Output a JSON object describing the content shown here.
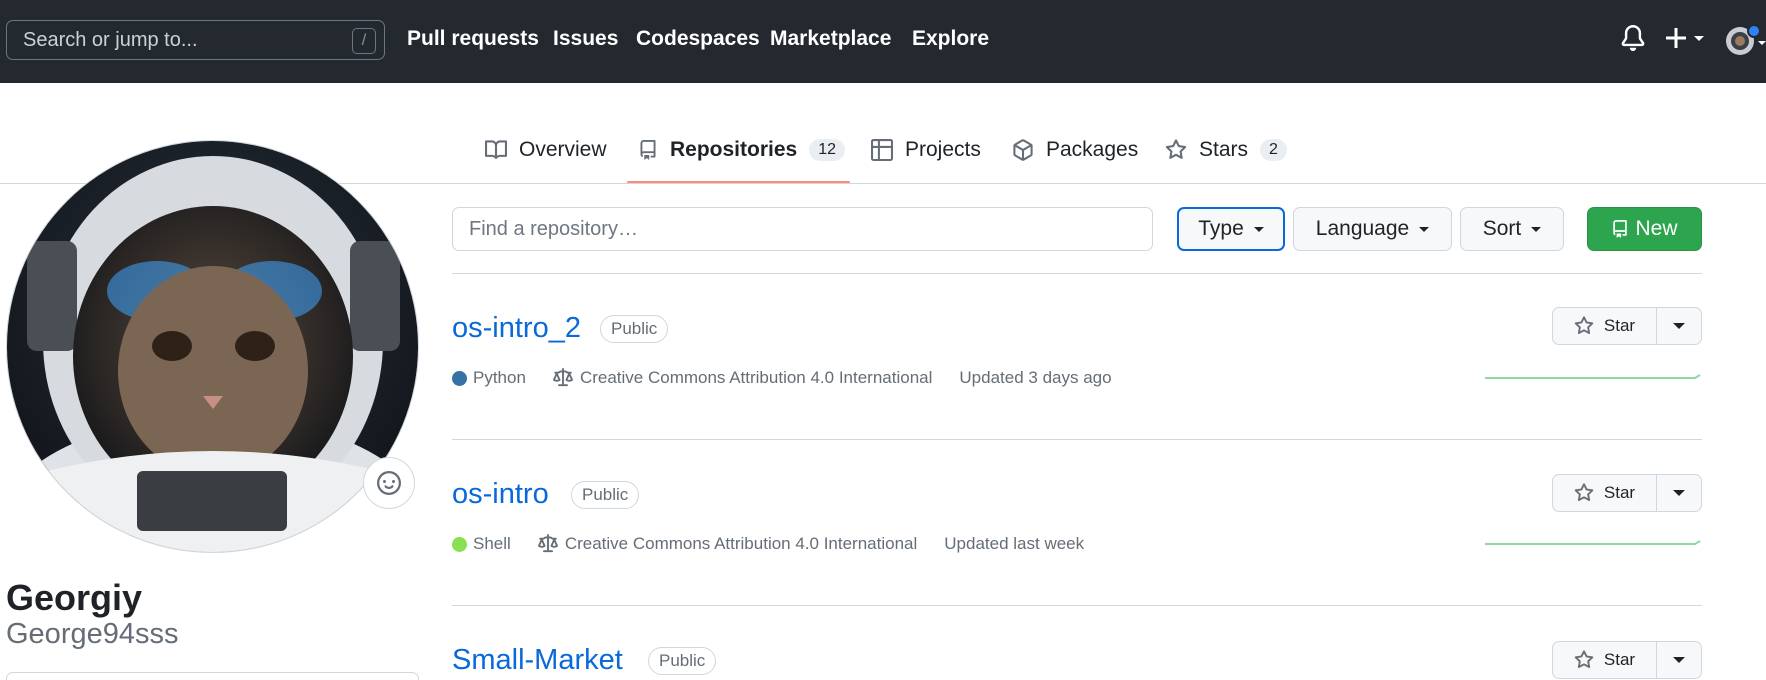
{
  "header": {
    "search_placeholder": "Search or jump to...",
    "search_shortcut": "/",
    "nav": [
      "Pull requests",
      "Issues",
      "Codespaces",
      "Marketplace",
      "Explore"
    ]
  },
  "tabs": [
    {
      "label": "Overview",
      "icon": "book-icon"
    },
    {
      "label": "Repositories",
      "icon": "repo-icon",
      "count": "12",
      "active": true
    },
    {
      "label": "Projects",
      "icon": "table-icon"
    },
    {
      "label": "Packages",
      "icon": "package-icon"
    },
    {
      "label": "Stars",
      "icon": "star-icon",
      "count": "2"
    }
  ],
  "profile": {
    "full_name": "Georgiy",
    "username": "George94sss"
  },
  "filters": {
    "search_placeholder": "Find a repository…",
    "type_label": "Type",
    "language_label": "Language",
    "sort_label": "Sort",
    "new_label": "New"
  },
  "repos": [
    {
      "name": "os-intro_2",
      "visibility": "Public",
      "language": "Python",
      "language_color": "#3572A5",
      "license": "Creative Commons Attribution 4.0 International",
      "updated": "Updated 3 days ago",
      "star_label": "Star"
    },
    {
      "name": "os-intro",
      "visibility": "Public",
      "language": "Shell",
      "language_color": "#89e051",
      "license": "Creative Commons Attribution 4.0 International",
      "updated": "Updated last week",
      "star_label": "Star"
    },
    {
      "name": "Small-Market",
      "visibility": "Public",
      "star_label": "Star"
    }
  ],
  "colors": {
    "header_bg": "#24292f",
    "link": "#0969da",
    "primary_button": "#2da44e",
    "tab_underline": "#fd8c73"
  }
}
